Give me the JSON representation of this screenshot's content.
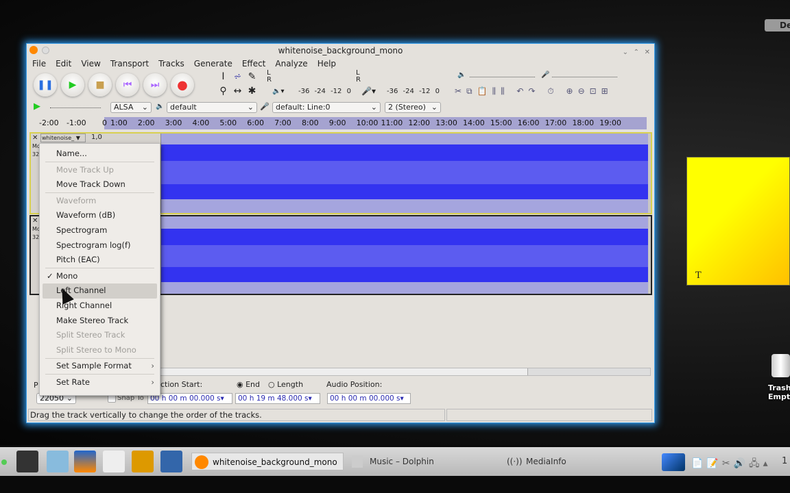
{
  "window": {
    "title": "whitenoise_background_mono"
  },
  "menubar": [
    "File",
    "Edit",
    "View",
    "Transport",
    "Tracks",
    "Generate",
    "Effect",
    "Analyze",
    "Help"
  ],
  "transport": {
    "pause": "pause-icon",
    "play": "play-icon",
    "stop": "stop-icon",
    "skip_start": "skip-start-icon",
    "skip_end": "skip-end-icon",
    "record": "record-icon"
  },
  "meters": {
    "left": "L",
    "right": "R",
    "scale": [
      "-36",
      "-24",
      "-12",
      "0"
    ]
  },
  "device": {
    "host": "ALSA",
    "output": "default",
    "input": "default: Line:0",
    "channels": "2 (Stereo)"
  },
  "ruler": [
    "-2:00",
    "-1:00",
    "0",
    "1:00",
    "2:00",
    "3:00",
    "4:00",
    "5:00",
    "6:00",
    "7:00",
    "8:00",
    "9:00",
    "10:00",
    "11:00",
    "12:00",
    "13:00",
    "14:00",
    "15:00",
    "16:00",
    "17:00",
    "18:00",
    "19:00"
  ],
  "track1": {
    "name": "whitenoise_",
    "value": "1,0",
    "info": [
      "Mo",
      "32"
    ]
  },
  "track2": {
    "info": [
      "Mo",
      "32"
    ]
  },
  "context_menu": [
    {
      "label": "Name...",
      "disabled": false
    },
    {
      "sep": true
    },
    {
      "label": "Move Track Up",
      "disabled": true
    },
    {
      "label": "Move Track Down",
      "disabled": false
    },
    {
      "sep": true
    },
    {
      "label": "Waveform",
      "disabled": true
    },
    {
      "label": "Waveform (dB)",
      "disabled": false
    },
    {
      "label": "Spectrogram",
      "disabled": false
    },
    {
      "label": "Spectrogram log(f)",
      "disabled": false
    },
    {
      "label": "Pitch (EAC)",
      "disabled": false
    },
    {
      "sep": true
    },
    {
      "label": "Mono",
      "checked": true
    },
    {
      "label": "Left Channel",
      "highlighted": true
    },
    {
      "label": "Right Channel"
    },
    {
      "label": "Make Stereo Track"
    },
    {
      "label": "Split Stereo Track",
      "disabled": true
    },
    {
      "label": "Split Stereo to Mono",
      "disabled": true
    },
    {
      "sep": true
    },
    {
      "label": "Set Sample Format",
      "submenu": true
    },
    {
      "sep": true
    },
    {
      "label": "Set Rate",
      "submenu": true
    }
  ],
  "selection": {
    "project_rate_label": "P",
    "rate": "22050",
    "snap_to": "Snap To",
    "start_label": "ction Start:",
    "end_label": "End",
    "length_label": "Length",
    "audio_position_label": "Audio Position:",
    "start": "00 h 00 m 00.000 s",
    "end": "00 h 19 m 48.000 s",
    "position": "00 h 00 m 00.000 s"
  },
  "status": "Drag the track vertically to change the order of the tracks.",
  "desktop": {
    "top_button": "De",
    "trash_label1": "Trash",
    "trash_label2": "Empt",
    "note_glyph": "T"
  },
  "taskbar": {
    "tasks": [
      "whitenoise_background_mono",
      "Music – Dolphin",
      "MediaInfo"
    ],
    "clock": "1"
  }
}
